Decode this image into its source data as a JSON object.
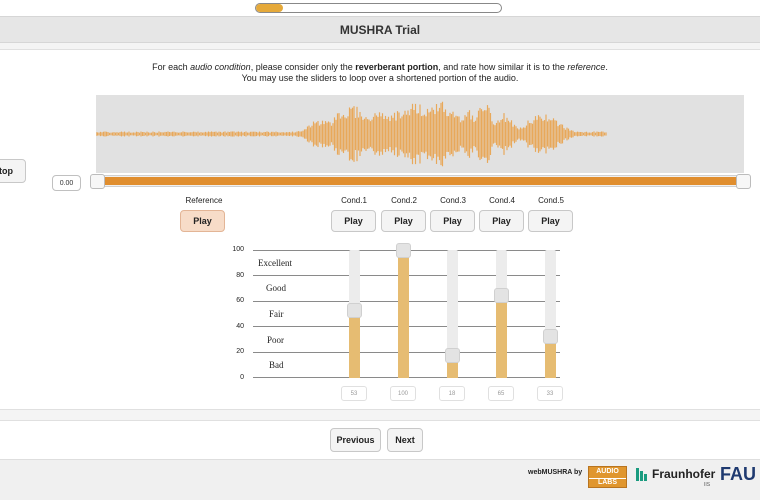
{
  "progress": {
    "fraction": 0.11
  },
  "header": {
    "title": "MUSHRA Trial"
  },
  "instructions": {
    "line1_prefix": "For each ",
    "line1_italic1": "audio condition",
    "line1_mid": ", please consider only the ",
    "line1_bold": "reverberant portion",
    "line1_mid2": ", and rate how similar it is to the ",
    "line1_italic2": "reference",
    "line1_suffix": ".",
    "line2": "You may use the sliders to loop over a shortened portion of the audio."
  },
  "controls": {
    "stop_label": "top"
  },
  "loop": {
    "start_value": "0.00"
  },
  "reference": {
    "label": "Reference",
    "play_label": "Play"
  },
  "conditions": [
    {
      "label": "Cond.1",
      "play_label": "Play",
      "value": "53"
    },
    {
      "label": "Cond.2",
      "play_label": "Play",
      "value": "100"
    },
    {
      "label": "Cond.3",
      "play_label": "Play",
      "value": "18"
    },
    {
      "label": "Cond.4",
      "play_label": "Play",
      "value": "65"
    },
    {
      "label": "Cond.5",
      "play_label": "Play",
      "value": "33"
    }
  ],
  "scale": {
    "ticks": [
      "100",
      "80",
      "60",
      "40",
      "20",
      "0"
    ],
    "qualities": [
      "Excellent",
      "Good",
      "Fair",
      "Poor",
      "Bad"
    ]
  },
  "nav": {
    "previous_label": "Previous",
    "next_label": "Next"
  },
  "footer": {
    "brand": "webMUSHRA by",
    "audiolabs_line1": "AUDIO",
    "audiolabs_line2": "LABS",
    "fraunhofer": "Fraunhofer",
    "iis": "IIS",
    "fau": "FAU"
  },
  "colors": {
    "accent": "#e08e2f",
    "waveform": "#e8a85a",
    "slider_fill": "#e6bc72",
    "progress": "#e5a93a"
  }
}
